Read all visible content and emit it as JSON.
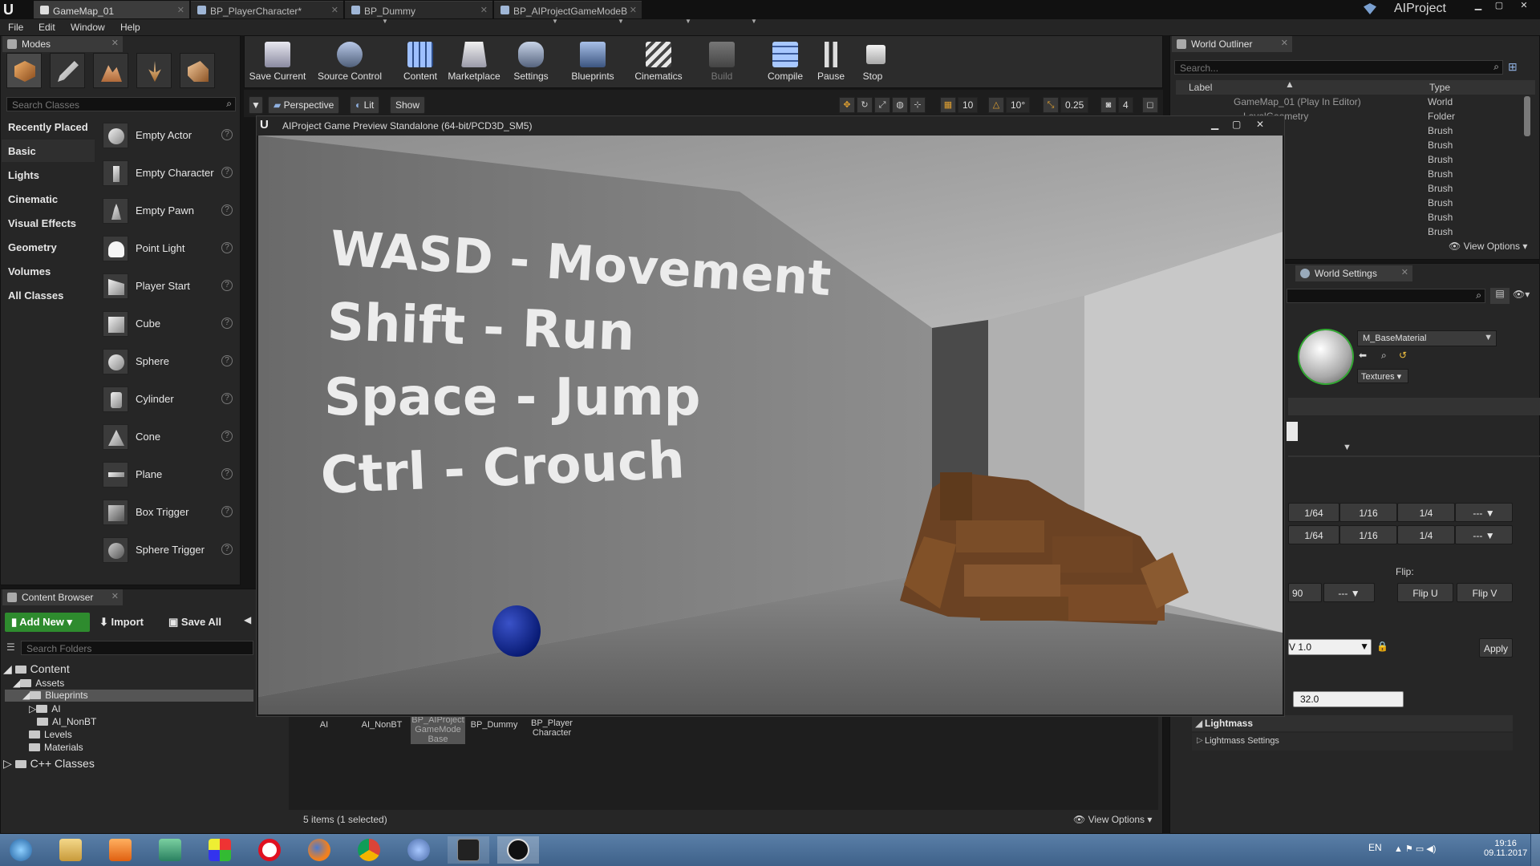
{
  "title_bar": {
    "tabs": [
      {
        "label": "GameMap_01",
        "active": true
      },
      {
        "label": "BP_PlayerCharacter*",
        "active": false
      },
      {
        "label": "BP_Dummy",
        "active": false
      },
      {
        "label": "BP_AIProjectGameModeB",
        "active": false
      }
    ],
    "project_name": "AIProject"
  },
  "menu": [
    "File",
    "Edit",
    "Window",
    "Help"
  ],
  "modes_panel": {
    "tab_label": "Modes",
    "search_placeholder": "Search Classes",
    "categories": [
      "Recently Placed",
      "Basic",
      "Lights",
      "Cinematic",
      "Visual Effects",
      "Geometry",
      "Volumes",
      "All Classes"
    ],
    "active_category": "Basic",
    "items": [
      "Empty Actor",
      "Empty Character",
      "Empty Pawn",
      "Point Light",
      "Player Start",
      "Cube",
      "Sphere",
      "Cylinder",
      "Cone",
      "Plane",
      "Box Trigger",
      "Sphere Trigger"
    ],
    "help_glyph": "?"
  },
  "toolbar": [
    {
      "label": "Save Current",
      "icon": "save-icon"
    },
    {
      "label": "Source Control",
      "icon": "source-control-icon"
    },
    {
      "label": "Content",
      "icon": "content-icon"
    },
    {
      "label": "Marketplace",
      "icon": "marketplace-icon"
    },
    {
      "label": "Settings",
      "icon": "settings-icon"
    },
    {
      "label": "Blueprints",
      "icon": "blueprints-icon"
    },
    {
      "label": "Cinematics",
      "icon": "cinematics-icon"
    },
    {
      "label": "Build",
      "icon": "build-icon"
    },
    {
      "label": "Compile",
      "icon": "compile-icon"
    },
    {
      "label": "Pause",
      "icon": "pause-icon"
    },
    {
      "label": "Stop",
      "icon": "stop-icon"
    }
  ],
  "viewport_toolbar": {
    "perspective": "Perspective",
    "lit": "Lit",
    "show": "Show",
    "grid_snap": "10",
    "rotation_snap": "10°",
    "scale_snap": "0.25",
    "camera_speed": "4"
  },
  "game_window": {
    "title": "AIProject Game Preview Standalone (64-bit/PCD3D_SM5)",
    "controls": [
      "WASD - Movement",
      "Shift - Run",
      "Space - Jump",
      "Ctrl - Crouch"
    ]
  },
  "world_outliner": {
    "tab_label": "World Outliner",
    "search_placeholder": "Search...",
    "col_label": "Label",
    "col_type": "Type",
    "rows": [
      {
        "label": "GameMap_01 (Play In Editor)",
        "type": "World"
      },
      {
        "label": "LevelGeometry",
        "type": "Folder"
      },
      {
        "label": "",
        "type": "Brush"
      },
      {
        "label": "",
        "type": "Brush"
      },
      {
        "label": "",
        "type": "Brush"
      },
      {
        "label": "",
        "type": "Brush"
      },
      {
        "label": "",
        "type": "Brush"
      },
      {
        "label": "",
        "type": "Brush"
      },
      {
        "label": "",
        "type": "Brush"
      },
      {
        "label": "",
        "type": "Brush"
      }
    ],
    "view_options": "View Options"
  },
  "details": {
    "tab_label": "World Settings",
    "material_name": "M_BaseMaterial",
    "textures_button": "Textures",
    "grid_row_1": [
      "1/64",
      "1/16",
      "1/4",
      "---"
    ],
    "grid_row_2": [
      "1/64",
      "1/16",
      "1/4",
      "---"
    ],
    "flip_label": "Flip:",
    "rotate_value": "90",
    "rotate_dropdown": "---",
    "flip_u": "Flip U",
    "flip_v": "Flip V",
    "v_value": "V  1.0",
    "apply": "Apply",
    "lightmap_value": "32.0",
    "lightmass_header": "Lightmass",
    "lightmass_settings": "Lightmass Settings"
  },
  "content_browser": {
    "tab_label": "Content Browser",
    "add_new": "Add New",
    "import": "Import",
    "save_all": "Save All",
    "search_placeholder": "Search Folders",
    "tree": [
      {
        "label": "Content",
        "level": 0
      },
      {
        "label": "Assets",
        "level": 1
      },
      {
        "label": "Blueprints",
        "level": 2,
        "selected": true
      },
      {
        "label": "AI",
        "level": 3
      },
      {
        "label": "AI_NonBT",
        "level": 3
      },
      {
        "label": "Levels",
        "level": 2
      },
      {
        "label": "Materials",
        "level": 2
      },
      {
        "label": "C++ Classes",
        "level": 0
      }
    ],
    "assets": [
      {
        "label": "AI"
      },
      {
        "label": "AI_NonBT"
      },
      {
        "label": "BP_AIProject GameMode Base",
        "selected": true
      },
      {
        "label": "BP_Dummy"
      },
      {
        "label": "BP_Player Character"
      }
    ],
    "status": "5 items (1 selected)",
    "view_options": "View Options"
  },
  "taskbar": {
    "icons": [
      "windows-start-icon",
      "explorer-icon",
      "media-player-icon",
      "app-icon",
      "color-app-icon",
      "opera-icon",
      "firefox-icon",
      "chrome-icon",
      "game-app-icon",
      "epic-games-icon",
      "unreal-engine-icon"
    ],
    "language": "EN",
    "time": "19:16",
    "date": "09.11.2017"
  }
}
